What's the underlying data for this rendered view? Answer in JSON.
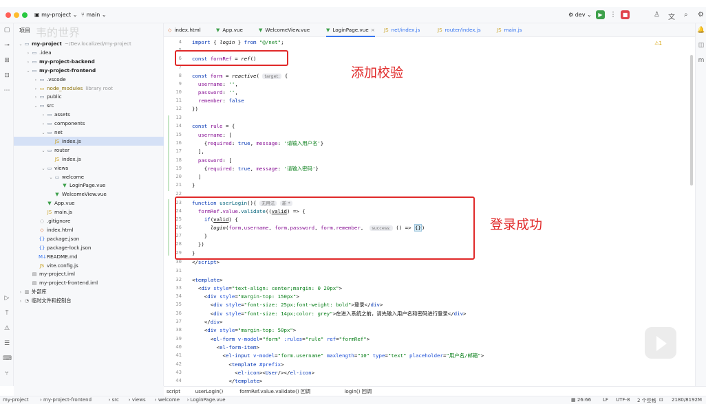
{
  "titlebar": {
    "project": "my-project",
    "branch": "main",
    "run_config": "dev"
  },
  "project_panel": {
    "title": "项目",
    "watermark": "韦的世界",
    "rows": [
      {
        "label": "my-project",
        "hint": "~/Dev.localized/my-project",
        "depth": 0,
        "chev": "⌄",
        "icon": "folder",
        "bold": true
      },
      {
        "label": ".idea",
        "hint": "",
        "depth": 1,
        "chev": "›",
        "icon": "folder",
        "bold": false
      },
      {
        "label": "my-project-backend",
        "hint": "",
        "depth": 1,
        "chev": "›",
        "icon": "folder",
        "bold": true
      },
      {
        "label": "my-project-frontend",
        "hint": "",
        "depth": 1,
        "chev": "⌄",
        "icon": "folder",
        "bold": true
      },
      {
        "label": ".vscode",
        "hint": "",
        "depth": 2,
        "chev": "›",
        "icon": "folder",
        "bold": false
      },
      {
        "label": "node_modules",
        "hint": "library root",
        "depth": 2,
        "chev": "›",
        "icon": "folder-lib",
        "bold": false
      },
      {
        "label": "public",
        "hint": "",
        "depth": 2,
        "chev": "›",
        "icon": "folder",
        "bold": false
      },
      {
        "label": "src",
        "hint": "",
        "depth": 2,
        "chev": "⌄",
        "icon": "folder",
        "bold": false
      },
      {
        "label": "assets",
        "hint": "",
        "depth": 3,
        "chev": "›",
        "icon": "folder",
        "bold": false
      },
      {
        "label": "components",
        "hint": "",
        "depth": 3,
        "chev": "›",
        "icon": "folder",
        "bold": false
      },
      {
        "label": "net",
        "hint": "",
        "depth": 3,
        "chev": "⌄",
        "icon": "folder",
        "bold": false
      },
      {
        "label": "index.js",
        "hint": "",
        "depth": 4,
        "chev": "",
        "icon": "js",
        "bold": false,
        "selected": true
      },
      {
        "label": "router",
        "hint": "",
        "depth": 3,
        "chev": "⌄",
        "icon": "folder",
        "bold": false
      },
      {
        "label": "index.js",
        "hint": "",
        "depth": 4,
        "chev": "",
        "icon": "js",
        "bold": false
      },
      {
        "label": "views",
        "hint": "",
        "depth": 3,
        "chev": "⌄",
        "icon": "folder",
        "bold": false
      },
      {
        "label": "welcome",
        "hint": "",
        "depth": 4,
        "chev": "⌄",
        "icon": "folder",
        "bold": false
      },
      {
        "label": "LoginPage.vue",
        "hint": "",
        "depth": 5,
        "chev": "",
        "icon": "vue",
        "bold": false
      },
      {
        "label": "WelcomeView.vue",
        "hint": "",
        "depth": 4,
        "chev": "",
        "icon": "vue",
        "bold": false
      },
      {
        "label": "App.vue",
        "hint": "",
        "depth": 3,
        "chev": "",
        "icon": "vue",
        "bold": false
      },
      {
        "label": "main.js",
        "hint": "",
        "depth": 3,
        "chev": "",
        "icon": "js",
        "bold": false
      },
      {
        "label": ".gitignore",
        "hint": "",
        "depth": 2,
        "chev": "",
        "icon": "git",
        "bold": false
      },
      {
        "label": "index.html",
        "hint": "",
        "depth": 2,
        "chev": "",
        "icon": "html",
        "bold": false
      },
      {
        "label": "package.json",
        "hint": "",
        "depth": 2,
        "chev": "",
        "icon": "json",
        "bold": false
      },
      {
        "label": "package-lock.json",
        "hint": "",
        "depth": 2,
        "chev": "",
        "icon": "json",
        "bold": false
      },
      {
        "label": "README.md",
        "hint": "",
        "depth": 2,
        "chev": "",
        "icon": "md",
        "bold": false
      },
      {
        "label": "vite.config.js",
        "hint": "",
        "depth": 2,
        "chev": "",
        "icon": "js",
        "bold": false
      },
      {
        "label": "my-project.iml",
        "hint": "",
        "depth": 1,
        "chev": "",
        "icon": "file",
        "bold": false
      },
      {
        "label": "my-project-frontend.iml",
        "hint": "",
        "depth": 1,
        "chev": "",
        "icon": "file",
        "bold": false
      },
      {
        "label": "外部库",
        "hint": "",
        "depth": 0,
        "chev": "›",
        "icon": "lib",
        "bold": false
      },
      {
        "label": "临时文件和控制台",
        "hint": "",
        "depth": 0,
        "chev": "›",
        "icon": "scratch",
        "bold": false
      }
    ]
  },
  "tabs": [
    {
      "label": "index.html",
      "icon": "html",
      "active": false
    },
    {
      "label": "App.vue",
      "icon": "vue",
      "active": false
    },
    {
      "label": "WelcomeView.vue",
      "icon": "vue",
      "active": false
    },
    {
      "label": "LoginPage.vue",
      "icon": "vue",
      "active": true,
      "close": "×"
    },
    {
      "label": "net/index.js",
      "icon": "js",
      "active": false
    },
    {
      "label": "router/index.js",
      "icon": "js",
      "active": false
    },
    {
      "label": "main.js",
      "icon": "js",
      "active": false
    }
  ],
  "editor": {
    "warning": "⚠1",
    "line_numbers": [
      "4",
      "5",
      "6",
      "7",
      "8",
      "9",
      "10",
      "11",
      "12",
      "13",
      "14",
      "15",
      "16",
      "17",
      "18",
      "19",
      "20",
      "21",
      "22",
      "23",
      "24",
      "25",
      "26",
      "27",
      "28",
      "29",
      "30",
      "31",
      "32",
      "33",
      "34",
      "35",
      "36",
      "37",
      "38",
      "39",
      "40",
      "41",
      "42",
      "43",
      "44"
    ],
    "annotation_top": "添加校验",
    "annotation_bottom": "登录成功",
    "inlay_target": "target:",
    "inlay_usage": "无用法",
    "inlay_new": "新 *",
    "inlay_success": "success:"
  },
  "breadcrumb": [
    "script",
    "userLogin()",
    "formRef.value.validate() 回调",
    "login() 回调"
  ],
  "status": {
    "path": [
      "my-project",
      "my-project-frontend",
      "src",
      "views",
      "welcome",
      "LoginPage.vue"
    ],
    "position": "26:66",
    "line_sep": "LF",
    "encoding": "UTF-8",
    "indent": "2 个空格",
    "memory": "2180/8192M"
  },
  "colors": {
    "accent": "#3574f0",
    "annotation": "#e02828",
    "run": "#3ea04b",
    "stop": "#e0434b"
  }
}
